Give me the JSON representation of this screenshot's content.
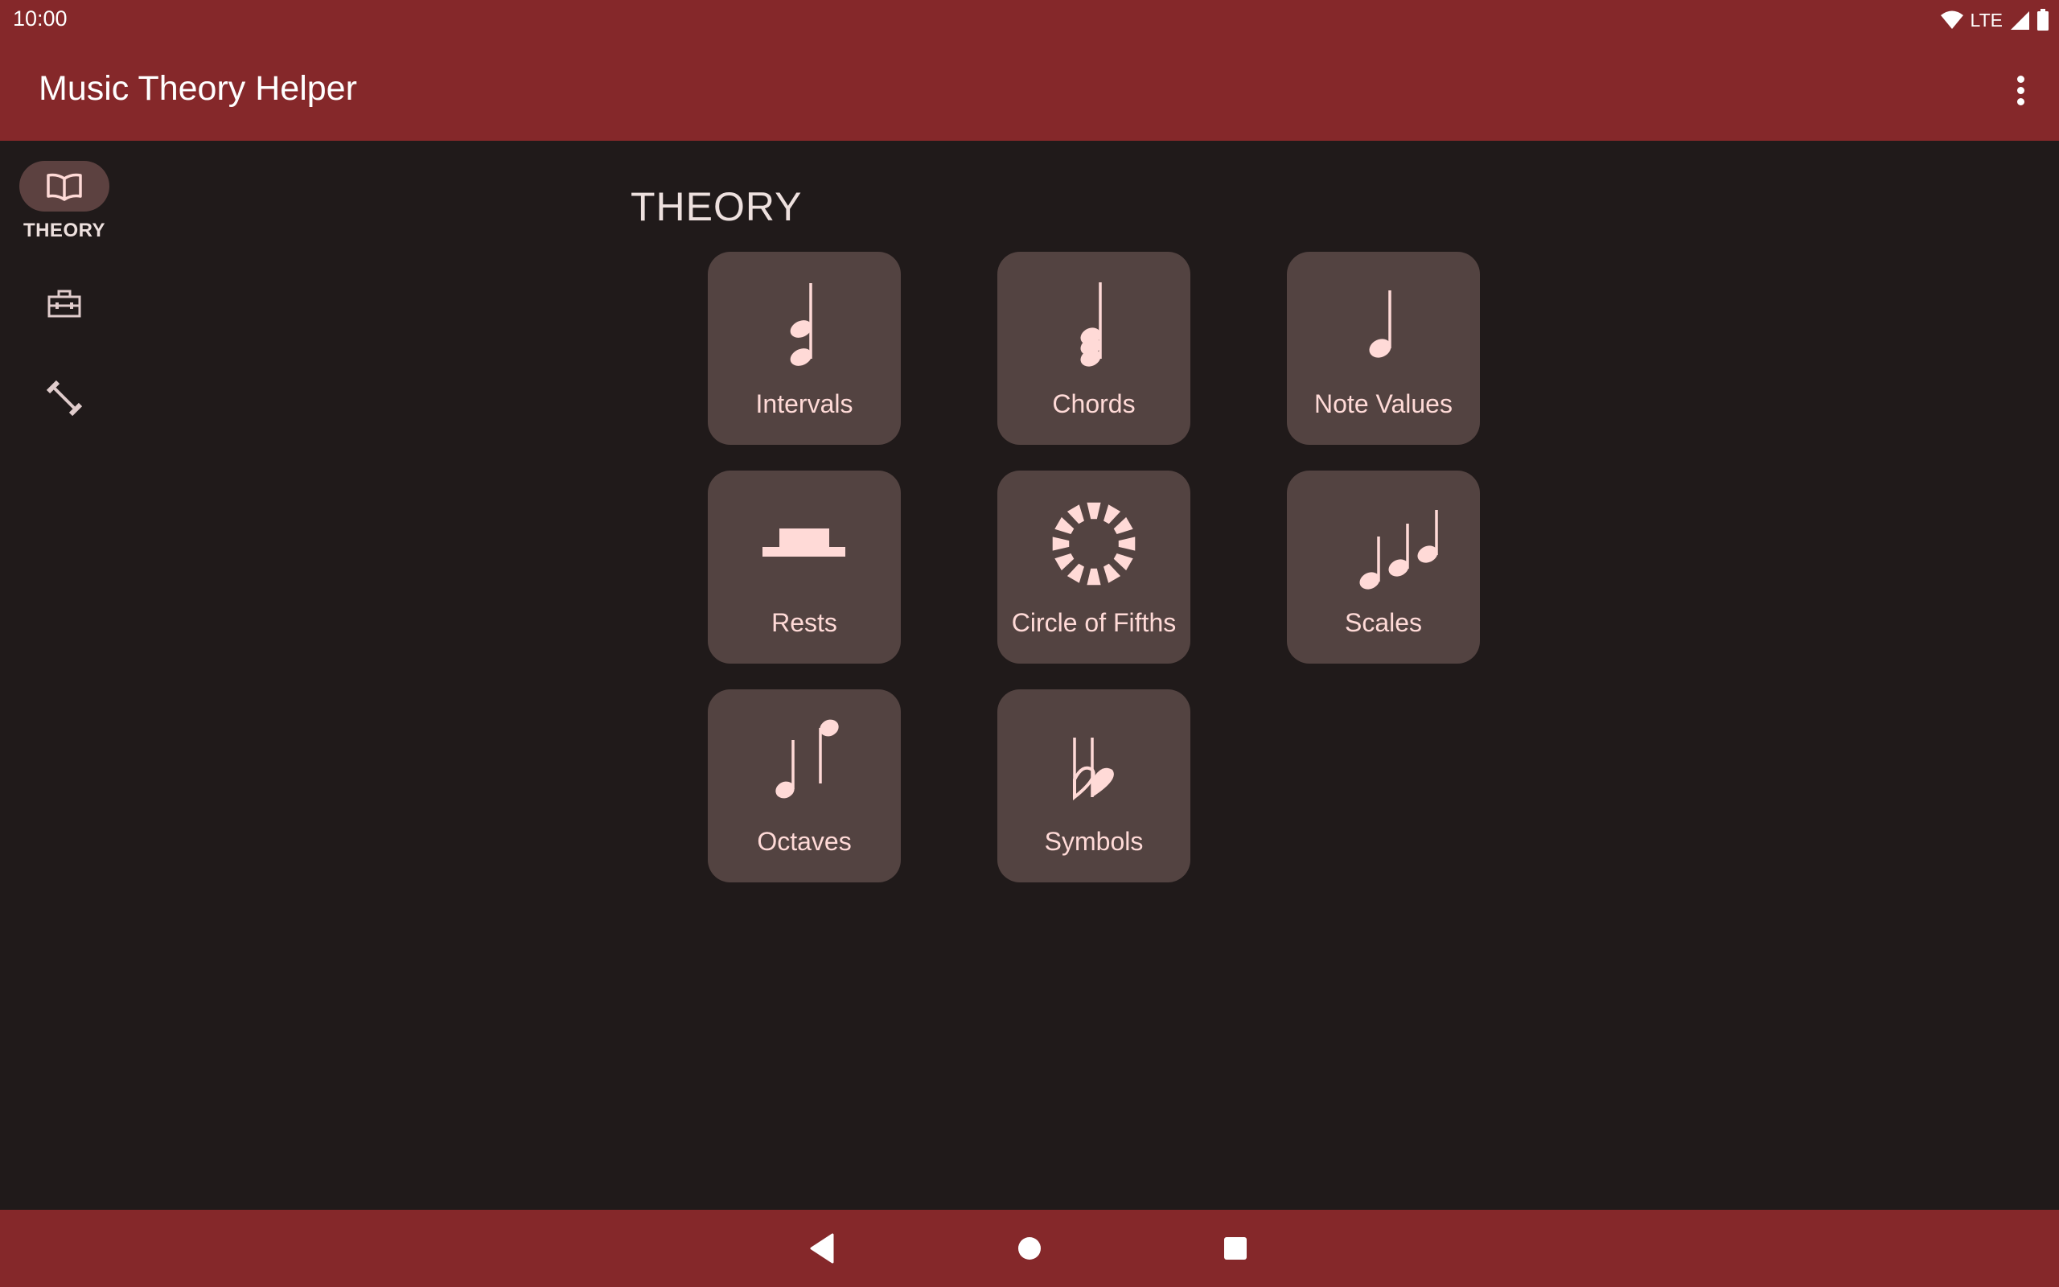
{
  "status_bar": {
    "time": "10:00",
    "network": "LTE",
    "icons": [
      "wifi-icon",
      "cell-signal-icon",
      "battery-icon"
    ]
  },
  "app_bar": {
    "title": "Music Theory Helper",
    "overflow_icon": "more-vert-icon"
  },
  "colors": {
    "primary": "#85282a",
    "background": "#201a1a",
    "card": "#534341",
    "on_card": "#ffdad7",
    "rail_indicator": "#5c4140",
    "on_surface": "#ede0de"
  },
  "nav_rail": {
    "items": [
      {
        "id": "theory",
        "label": "THEORY",
        "icon": "book-icon",
        "selected": true
      },
      {
        "id": "tools",
        "label": "",
        "icon": "toolbox-icon",
        "selected": false
      },
      {
        "id": "practice",
        "label": "",
        "icon": "dumbbell-icon",
        "selected": false
      }
    ]
  },
  "main": {
    "section_title": "THEORY",
    "cards": [
      {
        "label": "Intervals",
        "icon": "interval-notes-icon"
      },
      {
        "label": "Chords",
        "icon": "chord-notes-icon"
      },
      {
        "label": "Note Values",
        "icon": "quarter-note-icon"
      },
      {
        "label": "Rests",
        "icon": "half-rest-icon"
      },
      {
        "label": "Circle of Fifths",
        "icon": "circle-of-fifths-icon"
      },
      {
        "label": "Scales",
        "icon": "scale-notes-icon"
      },
      {
        "label": "Octaves",
        "icon": "octave-notes-icon"
      },
      {
        "label": "Symbols",
        "icon": "double-flat-icon"
      }
    ]
  },
  "system_nav": {
    "buttons": [
      {
        "id": "back",
        "icon": "back-triangle-icon"
      },
      {
        "id": "home",
        "icon": "home-circle-icon"
      },
      {
        "id": "recents",
        "icon": "recents-square-icon"
      }
    ]
  }
}
